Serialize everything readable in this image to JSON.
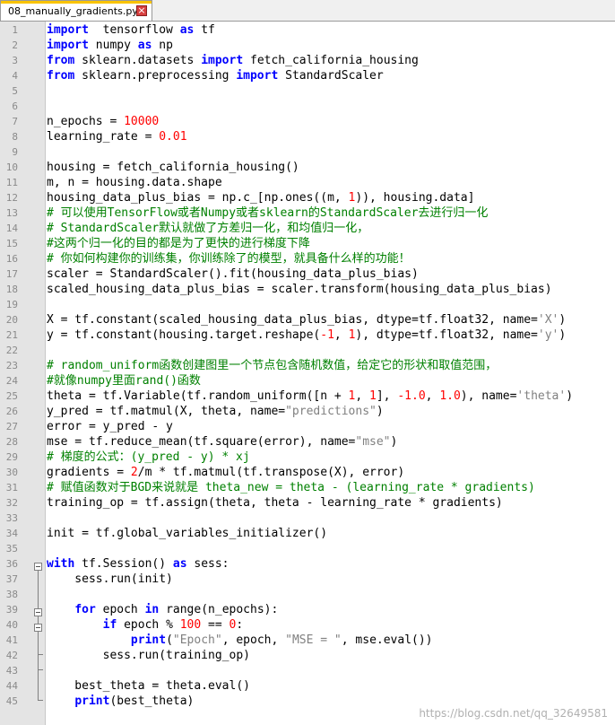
{
  "tab": {
    "title": "08_manually_gradients.py",
    "close_icon": "close-icon"
  },
  "watermark": "https://blog.csdn.net/qq_32649581",
  "colors": {
    "keyword": "#0000ff",
    "number": "#ff0000",
    "string": "#808080",
    "comment": "#008000",
    "tab_accent": "#f9c300"
  },
  "lines": [
    {
      "n": 1,
      "tokens": [
        [
          "kw",
          "import"
        ],
        [
          "",
          "  tensorflow "
        ],
        [
          "kw",
          "as"
        ],
        [
          "",
          " tf"
        ]
      ]
    },
    {
      "n": 2,
      "tokens": [
        [
          "kw",
          "import"
        ],
        [
          "",
          " numpy "
        ],
        [
          "kw",
          "as"
        ],
        [
          "",
          " np"
        ]
      ]
    },
    {
      "n": 3,
      "tokens": [
        [
          "kw",
          "from"
        ],
        [
          "",
          " sklearn.datasets "
        ],
        [
          "kw",
          "import"
        ],
        [
          "",
          " fetch_california_housing"
        ]
      ]
    },
    {
      "n": 4,
      "tokens": [
        [
          "kw",
          "from"
        ],
        [
          "",
          " sklearn.preprocessing "
        ],
        [
          "kw",
          "import"
        ],
        [
          "",
          " StandardScaler"
        ]
      ]
    },
    {
      "n": 5,
      "tokens": []
    },
    {
      "n": 6,
      "tokens": []
    },
    {
      "n": 7,
      "tokens": [
        [
          "",
          "n_epochs = "
        ],
        [
          "num",
          "10000"
        ]
      ]
    },
    {
      "n": 8,
      "tokens": [
        [
          "",
          "learning_rate = "
        ],
        [
          "num",
          "0.01"
        ]
      ]
    },
    {
      "n": 9,
      "tokens": []
    },
    {
      "n": 10,
      "tokens": [
        [
          "",
          "housing = fetch_california_housing()"
        ]
      ]
    },
    {
      "n": 11,
      "tokens": [
        [
          "",
          "m, n = housing.data.shape"
        ]
      ]
    },
    {
      "n": 12,
      "tokens": [
        [
          "",
          "housing_data_plus_bias = np.c_[np.ones((m, "
        ],
        [
          "num",
          "1"
        ],
        [
          "",
          ")), housing.data]"
        ]
      ]
    },
    {
      "n": 13,
      "tokens": [
        [
          "com",
          "# 可以使用TensorFlow或者Numpy或者sklearn的StandardScaler去进行归一化"
        ]
      ]
    },
    {
      "n": 14,
      "tokens": [
        [
          "com",
          "# StandardScaler默认就做了方差归一化，和均值归一化，"
        ]
      ]
    },
    {
      "n": 15,
      "tokens": [
        [
          "com",
          "#这两个归一化的目的都是为了更快的进行梯度下降"
        ]
      ]
    },
    {
      "n": 16,
      "tokens": [
        [
          "com",
          "# 你如何构建你的训练集，你训练除了的模型，就具备什么样的功能！"
        ]
      ]
    },
    {
      "n": 17,
      "tokens": [
        [
          "",
          "scaler = StandardScaler().fit(housing_data_plus_bias)"
        ]
      ]
    },
    {
      "n": 18,
      "tokens": [
        [
          "",
          "scaled_housing_data_plus_bias = scaler.transform(housing_data_plus_bias)"
        ]
      ]
    },
    {
      "n": 19,
      "tokens": []
    },
    {
      "n": 20,
      "tokens": [
        [
          "",
          "X = tf.constant(scaled_housing_data_plus_bias, dtype=tf.float32, name="
        ],
        [
          "str",
          "'X'"
        ],
        [
          "",
          ")"
        ]
      ]
    },
    {
      "n": 21,
      "tokens": [
        [
          "",
          "y = tf.constant(housing.target.reshape("
        ],
        [
          "num",
          "-1"
        ],
        [
          "",
          ", "
        ],
        [
          "num",
          "1"
        ],
        [
          "",
          "), dtype=tf.float32, name="
        ],
        [
          "str",
          "'y'"
        ],
        [
          "",
          ")"
        ]
      ]
    },
    {
      "n": 22,
      "tokens": []
    },
    {
      "n": 23,
      "tokens": [
        [
          "com",
          "# random_uniform函数创建图里一个节点包含随机数值，给定它的形状和取值范围，"
        ]
      ]
    },
    {
      "n": 24,
      "tokens": [
        [
          "com",
          "#就像numpy里面rand()函数"
        ]
      ]
    },
    {
      "n": 25,
      "tokens": [
        [
          "",
          "theta = tf.Variable(tf.random_uniform([n + "
        ],
        [
          "num",
          "1"
        ],
        [
          "",
          ", "
        ],
        [
          "num",
          "1"
        ],
        [
          "",
          "], "
        ],
        [
          "num",
          "-1.0"
        ],
        [
          "",
          ", "
        ],
        [
          "num",
          "1.0"
        ],
        [
          "",
          "), name="
        ],
        [
          "str",
          "'theta'"
        ],
        [
          "",
          ")"
        ]
      ]
    },
    {
      "n": 26,
      "tokens": [
        [
          "",
          "y_pred = tf.matmul(X, theta, name="
        ],
        [
          "str",
          "\"predictions\""
        ],
        [
          "",
          ")"
        ]
      ]
    },
    {
      "n": 27,
      "tokens": [
        [
          "",
          "error = y_pred - y"
        ]
      ]
    },
    {
      "n": 28,
      "tokens": [
        [
          "",
          "mse = tf.reduce_mean(tf.square(error), name="
        ],
        [
          "str",
          "\"mse\""
        ],
        [
          "",
          ")"
        ]
      ]
    },
    {
      "n": 29,
      "tokens": [
        [
          "com",
          "# 梯度的公式：(y_pred - y) * xj"
        ]
      ]
    },
    {
      "n": 30,
      "tokens": [
        [
          "",
          "gradients = "
        ],
        [
          "num",
          "2"
        ],
        [
          "",
          "/m * tf.matmul(tf.transpose(X), error)"
        ]
      ]
    },
    {
      "n": 31,
      "tokens": [
        [
          "com",
          "# 赋值函数对于BGD来说就是 theta_new = theta - (learning_rate * gradients)"
        ]
      ]
    },
    {
      "n": 32,
      "tokens": [
        [
          "",
          "training_op = tf.assign(theta, theta - learning_rate * gradients)"
        ]
      ]
    },
    {
      "n": 33,
      "tokens": []
    },
    {
      "n": 34,
      "tokens": [
        [
          "",
          "init = tf.global_variables_initializer()"
        ]
      ]
    },
    {
      "n": 35,
      "tokens": []
    },
    {
      "n": 36,
      "tokens": [
        [
          "kw",
          "with"
        ],
        [
          "",
          " tf.Session() "
        ],
        [
          "kw",
          "as"
        ],
        [
          "",
          " sess:"
        ]
      ]
    },
    {
      "n": 37,
      "tokens": [
        [
          "",
          "    sess.run(init)"
        ]
      ]
    },
    {
      "n": 38,
      "tokens": []
    },
    {
      "n": 39,
      "tokens": [
        [
          "",
          "    "
        ],
        [
          "kw",
          "for"
        ],
        [
          "",
          " epoch "
        ],
        [
          "kw",
          "in"
        ],
        [
          "",
          " range(n_epochs):"
        ]
      ]
    },
    {
      "n": 40,
      "tokens": [
        [
          "",
          "        "
        ],
        [
          "kw",
          "if"
        ],
        [
          "",
          " epoch % "
        ],
        [
          "num",
          "100"
        ],
        [
          "",
          " == "
        ],
        [
          "num",
          "0"
        ],
        [
          "",
          ":"
        ]
      ]
    },
    {
      "n": 41,
      "tokens": [
        [
          "",
          "            "
        ],
        [
          "kw",
          "print"
        ],
        [
          "",
          "("
        ],
        [
          "str",
          "\"Epoch\""
        ],
        [
          "",
          ", epoch, "
        ],
        [
          "str",
          "\"MSE = \""
        ],
        [
          "",
          ", mse.eval())"
        ]
      ]
    },
    {
      "n": 42,
      "tokens": [
        [
          "",
          "        sess.run(training_op)"
        ]
      ]
    },
    {
      "n": 43,
      "tokens": []
    },
    {
      "n": 44,
      "tokens": [
        [
          "",
          "    best_theta = theta.eval()"
        ]
      ]
    },
    {
      "n": 45,
      "tokens": [
        [
          "",
          "    "
        ],
        [
          "kw",
          "print"
        ],
        [
          "",
          "(best_theta)"
        ]
      ]
    }
  ]
}
